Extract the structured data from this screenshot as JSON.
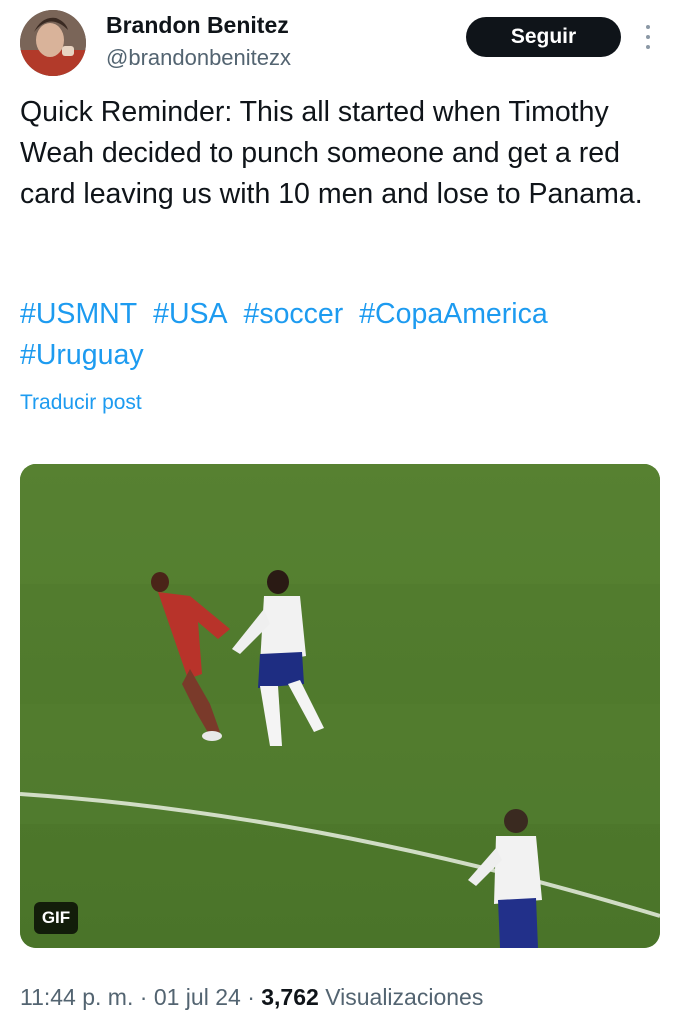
{
  "author": {
    "name": "Brandon Benitez",
    "handle": "@brandonbenitezx",
    "avatar_icon": "user-avatar-photo"
  },
  "follow_button": {
    "label": "Seguir"
  },
  "more_menu": {
    "icon": "more-vertical-icon"
  },
  "post": {
    "text": "Quick Reminder: This all started when Timothy Weah decided to punch someone and get a red card leaving us with 10 men and lose to Panama.",
    "hashtags": [
      "#USMNT",
      "#USA",
      "#soccer",
      "#CopaAmerica",
      "#Uruguay"
    ],
    "translate_label": "Traducir post"
  },
  "media": {
    "badge": "GIF",
    "pitch_color": "#4f7a2c"
  },
  "meta": {
    "time": "11:44 p. m.",
    "separator": "·",
    "date": "01 jul 24",
    "views_count": "3,762",
    "views_label": "Visualizaciones"
  },
  "colors": {
    "text": "#0f1419",
    "secondary": "#536471",
    "link": "#1d9bf0",
    "button": "#0f1419"
  }
}
